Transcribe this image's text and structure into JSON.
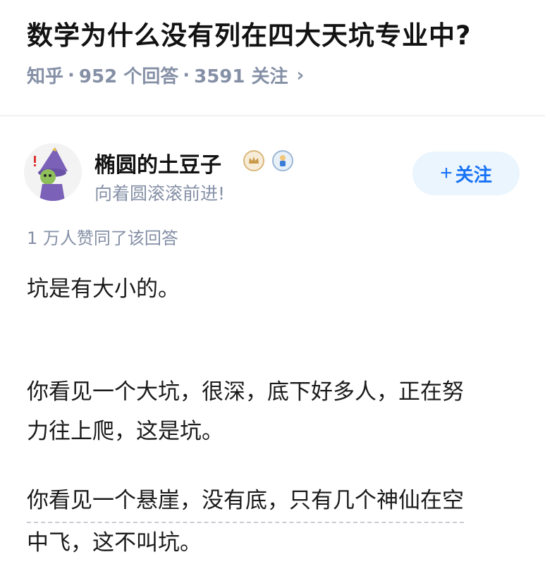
{
  "question": {
    "title": "数学为什么没有列在四大天坑专业中?",
    "site": "知乎",
    "answers": "952 个回答",
    "followers": "3591 关注",
    "separator": "·",
    "chevron": "›"
  },
  "author": {
    "name": "椭圆的土豆子",
    "bio": "向着圆滚滚前进!",
    "follow_plus": "+",
    "follow_label": "关注",
    "badges": [
      "crown-badge-icon",
      "figure-badge-icon"
    ]
  },
  "answer": {
    "vote_summary": "1 万人赞同了该回答",
    "paragraphs": [
      [
        "坑是有大小的。"
      ],
      [
        "你看见一个大坑，很深，底下好多人，正在努",
        "力往上爬，这是坑。"
      ],
      [
        "你看见一个悬崖，没有底，只有几个神仙在空",
        "中飞，这不叫坑。"
      ]
    ]
  },
  "colors": {
    "accent": "#1772f6",
    "follow_bg": "#ebf5fd",
    "meta_gray": "#8590a6",
    "text": "#1a1a1a"
  }
}
